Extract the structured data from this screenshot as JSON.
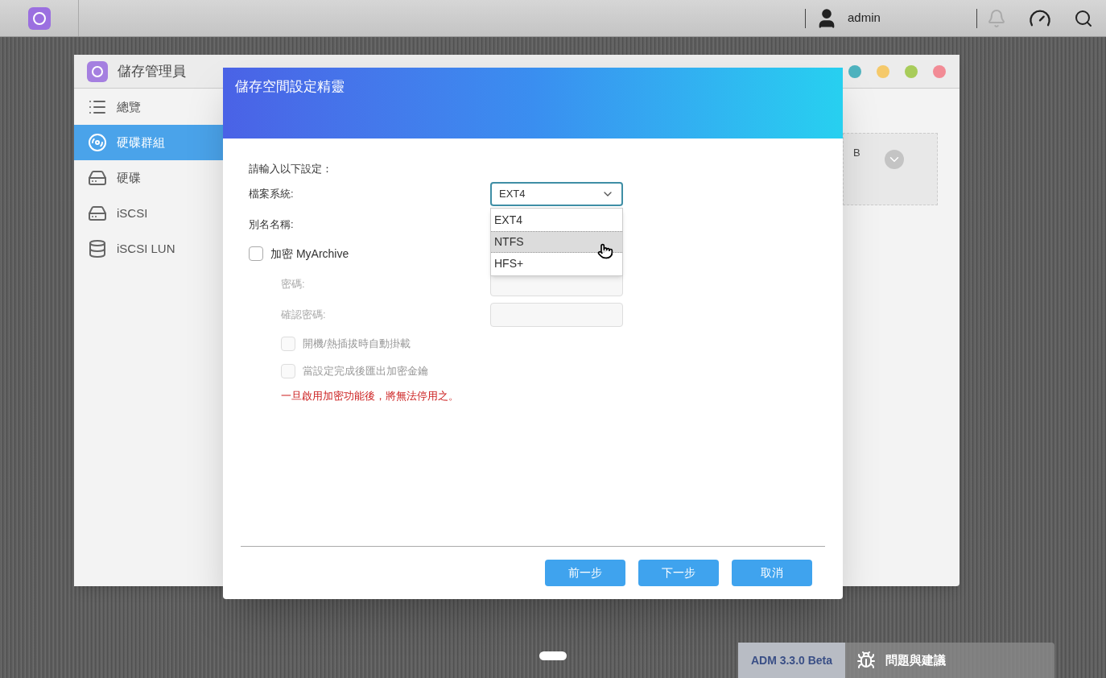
{
  "top_bar": {
    "user": "admin"
  },
  "app_window": {
    "title": "儲存管理員",
    "window_controls": [
      {
        "color": "#4fb3bf"
      },
      {
        "color": "#f5c96a"
      },
      {
        "color": "#a8cc5a"
      },
      {
        "color": "#f28b95"
      }
    ],
    "sidebar": {
      "items": [
        {
          "label": "總覽",
          "kind": "list",
          "selected": false
        },
        {
          "label": "硬碟群組",
          "kind": "disk-group",
          "selected": true
        },
        {
          "label": "硬碟",
          "kind": "drive",
          "selected": false
        },
        {
          "label": "iSCSI",
          "kind": "iscsi",
          "selected": false
        },
        {
          "label": "iSCSI LUN",
          "kind": "database",
          "selected": false
        }
      ]
    },
    "background_card": {
      "text": "B"
    }
  },
  "dialog": {
    "title": "儲存空間設定精靈",
    "prompt": "請輸入以下設定：",
    "file_system": {
      "label": "檔案系統:",
      "value": "EXT4",
      "expanded": true,
      "options": [
        {
          "label": "EXT4",
          "highlighted": false
        },
        {
          "label": "NTFS",
          "highlighted": true
        },
        {
          "label": "HFS+",
          "highlighted": false
        }
      ]
    },
    "alias": {
      "label": "別名名稱:"
    },
    "encrypt": {
      "label": "加密 MyArchive",
      "checked": false
    },
    "password_fields": [
      {
        "label": "密碼:",
        "disabled": true
      },
      {
        "label": "確認密碼:",
        "disabled": true
      }
    ],
    "options": [
      {
        "label": "開機/熱插拔時自動掛載",
        "checked": false,
        "disabled": true
      },
      {
        "label": "當設定完成後匯出加密金鑰",
        "checked": false,
        "disabled": true
      }
    ],
    "warning": "一旦啟用加密功能後，將無法停用之。",
    "buttons": [
      "前一步",
      "下一步",
      "取消"
    ]
  },
  "taskbar": {
    "version": "ADM 3.3.0 Beta",
    "feedback": "問題與建議"
  }
}
